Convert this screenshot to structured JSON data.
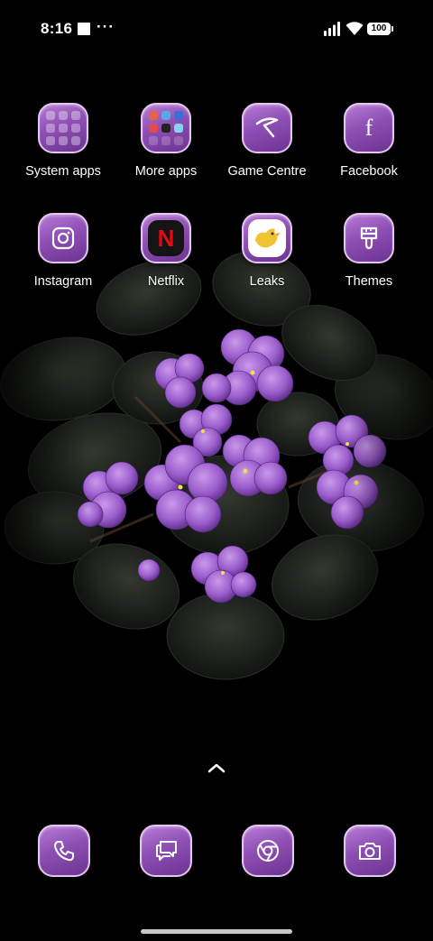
{
  "status_bar": {
    "time": "8:16",
    "overflow_indicator": "···",
    "battery_level": "100",
    "icons": [
      "square-notification-icon",
      "signal-icon",
      "wifi-icon",
      "battery-icon"
    ]
  },
  "apps": [
    {
      "label": "System apps",
      "icon": "folder-icon"
    },
    {
      "label": "More apps",
      "icon": "folder-icon"
    },
    {
      "label": "Game Centre",
      "icon": "game-centre-icon"
    },
    {
      "label": "Facebook",
      "icon": "facebook-icon"
    },
    {
      "label": "Instagram",
      "icon": "instagram-icon"
    },
    {
      "label": "Netflix",
      "icon": "netflix-icon"
    },
    {
      "label": "Leaks",
      "icon": "leaks-bird-icon"
    },
    {
      "label": "Themes",
      "icon": "themes-brush-icon"
    }
  ],
  "netflix_letter": "N",
  "facebook_letter": "f",
  "dock": [
    {
      "icon": "phone-icon"
    },
    {
      "icon": "messages-icon"
    },
    {
      "icon": "chrome-icon"
    },
    {
      "icon": "camera-icon"
    }
  ],
  "colors": {
    "icon_tile_top": "#b77ad6",
    "icon_tile_bottom": "#6c3391",
    "icon_border": "#e3c7f1",
    "netflix_red": "#e50914",
    "background": "#000000"
  }
}
